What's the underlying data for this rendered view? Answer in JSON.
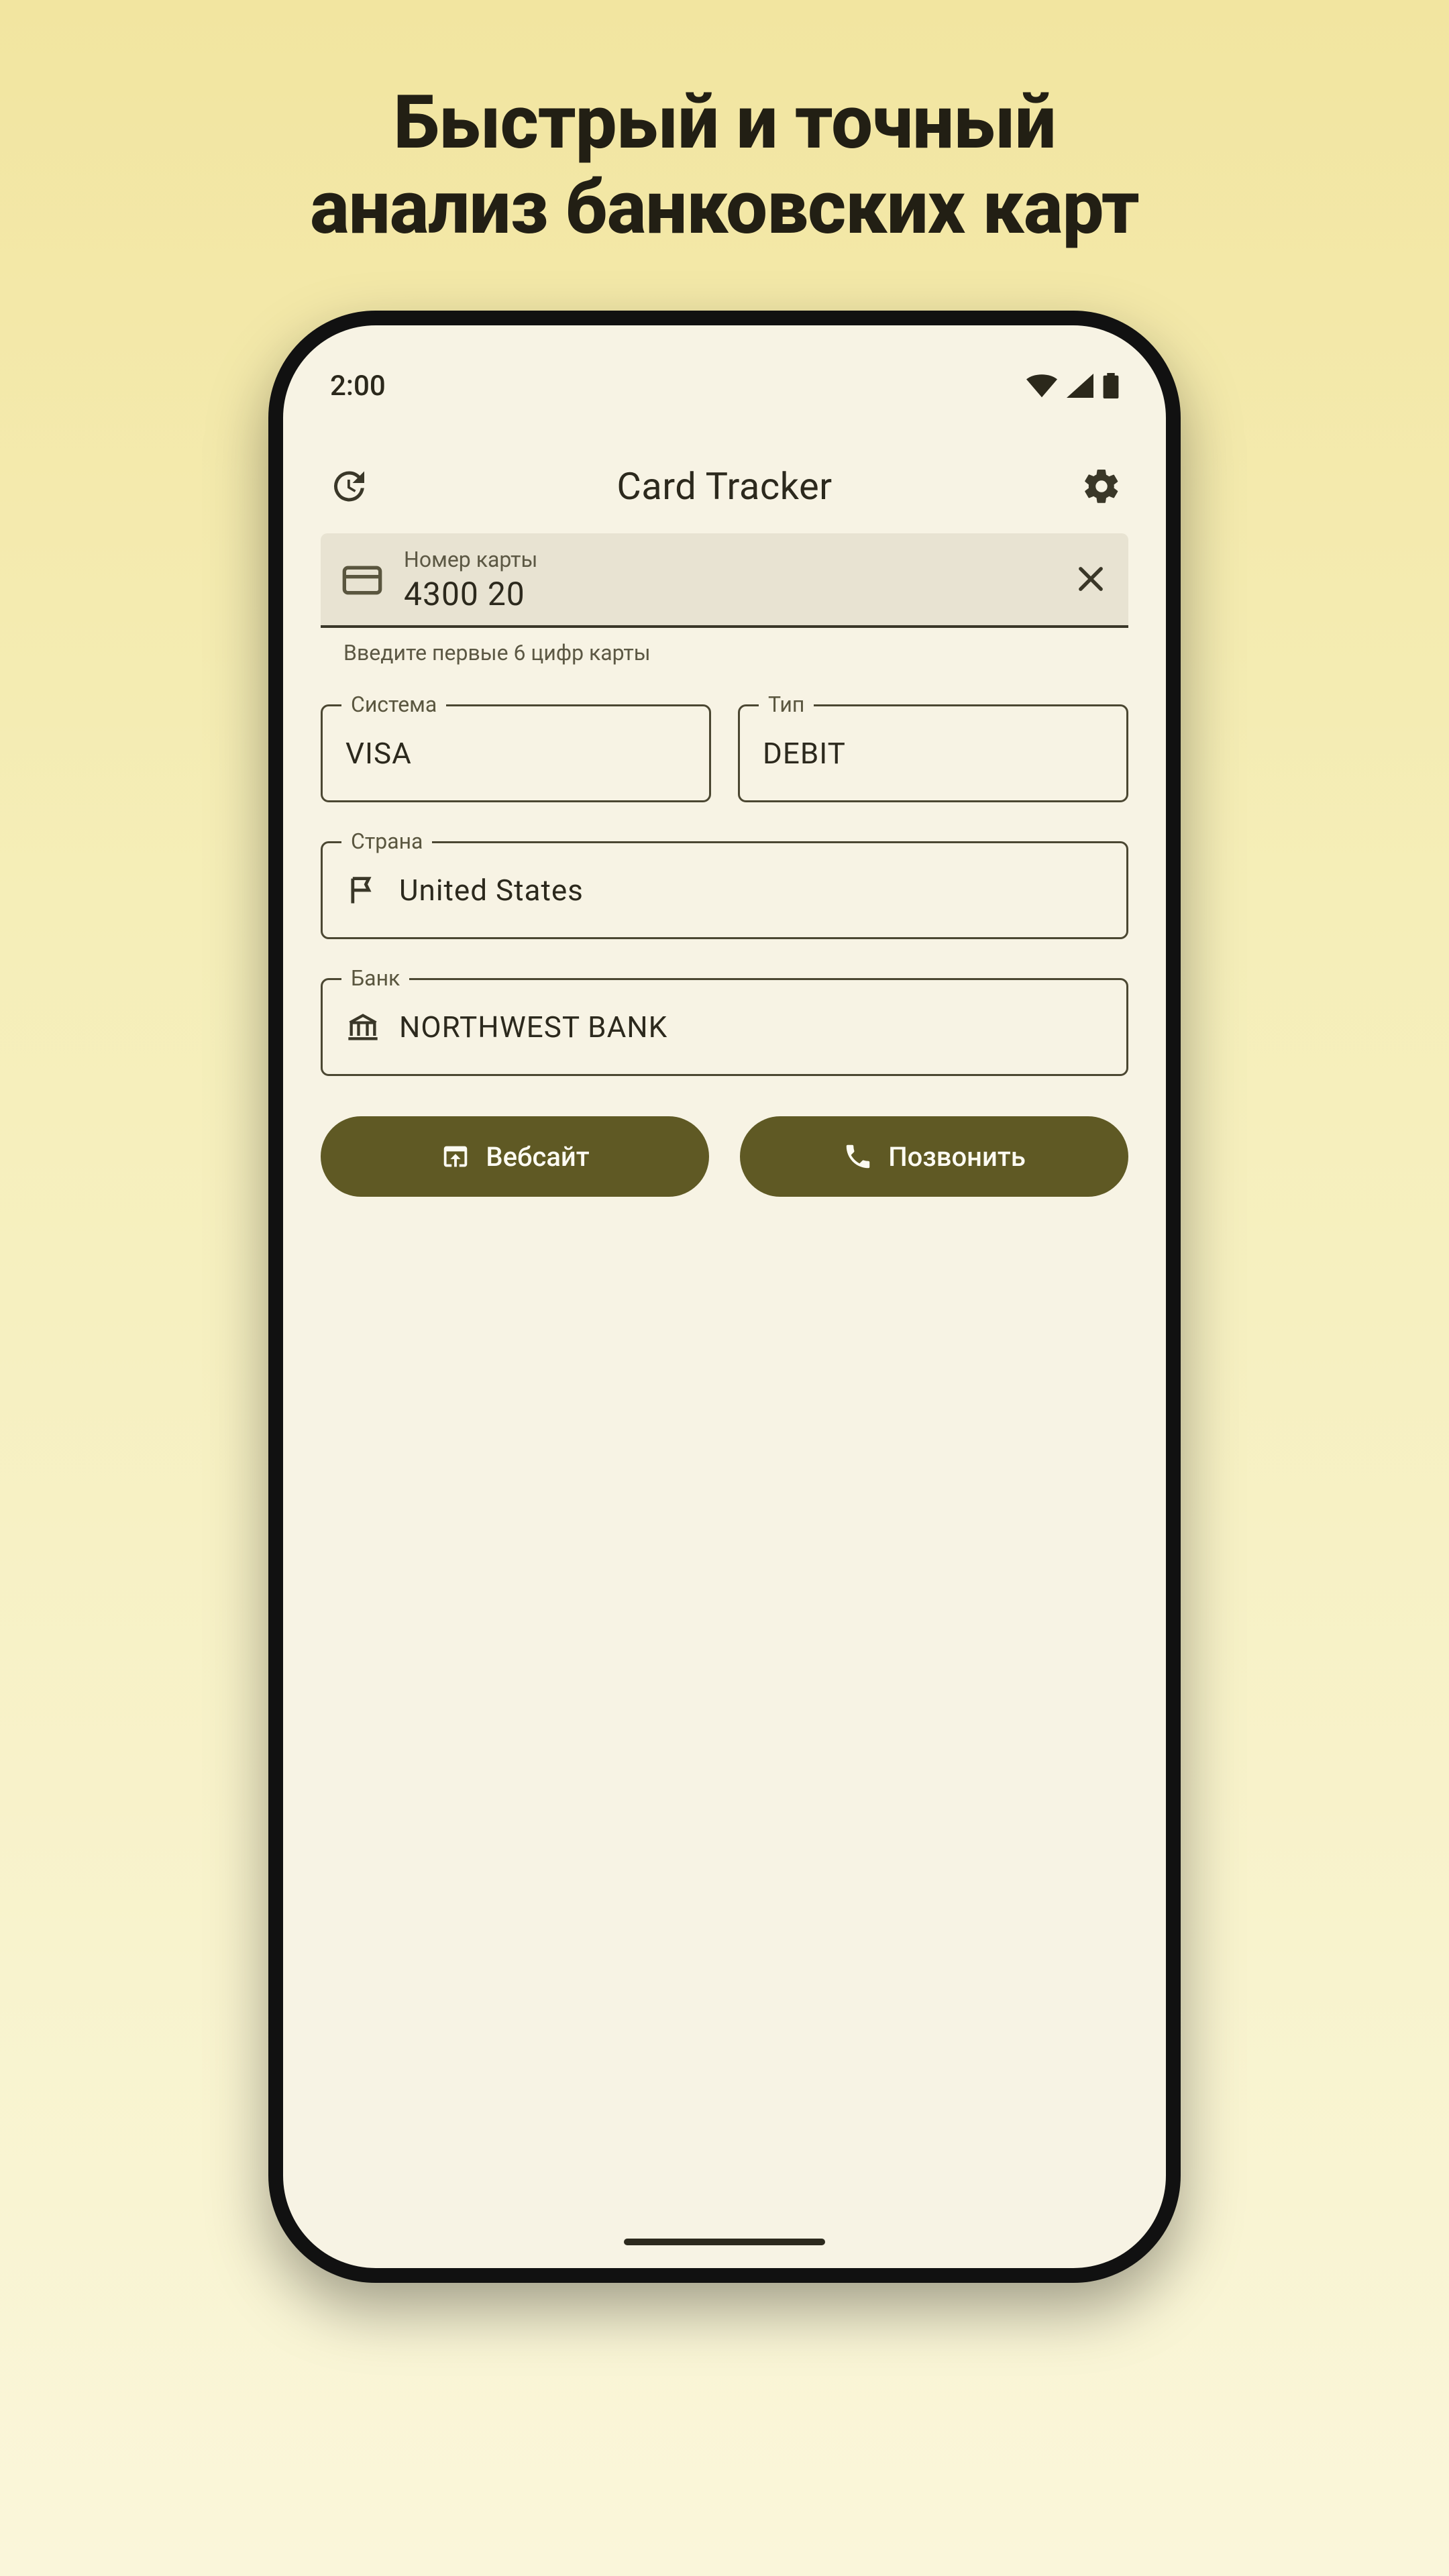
{
  "headline_line1": "Быстрый и точный",
  "headline_line2": "анализ банковских карт",
  "status": {
    "time": "2:00"
  },
  "app": {
    "title": "Card Tracker"
  },
  "input": {
    "label": "Номер карты",
    "value": "4300 20",
    "helper": "Введите первые 6 цифр карты"
  },
  "fields": {
    "system": {
      "label": "Система",
      "value": "VISA"
    },
    "type": {
      "label": "Тип",
      "value": "DEBIT"
    },
    "country": {
      "label": "Страна",
      "value": "United States"
    },
    "bank": {
      "label": "Банк",
      "value": "NORTHWEST BANK"
    }
  },
  "buttons": {
    "website": "Вебсайт",
    "call": "Позвонить"
  }
}
